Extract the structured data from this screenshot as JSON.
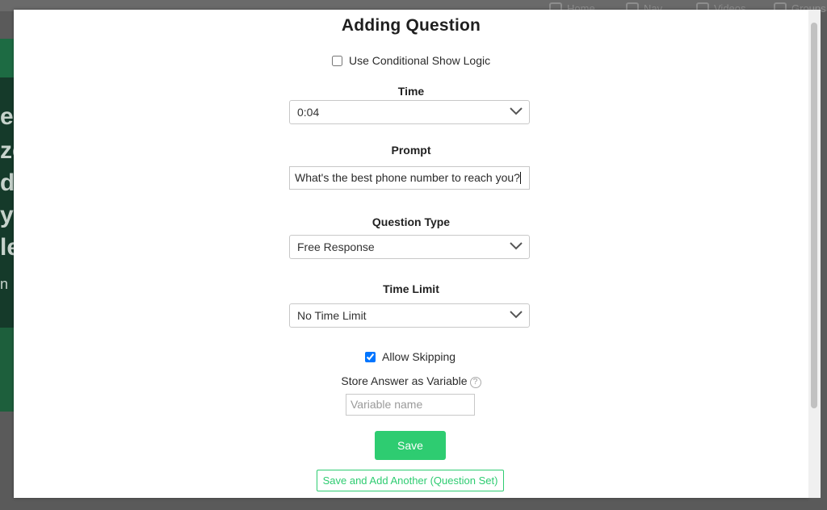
{
  "background_nav": {
    "items": [
      "Home",
      "Nav",
      "Videos",
      "Groups"
    ]
  },
  "background_letters": [
    "er",
    "ze",
    "d",
    "yo",
    "le",
    "n"
  ],
  "modal": {
    "title": "Adding Question",
    "conditional_logic": {
      "label": "Use Conditional Show Logic",
      "checked": false
    },
    "time": {
      "label": "Time",
      "value": "0:04"
    },
    "prompt": {
      "label": "Prompt",
      "value": "What's the best phone number to reach you?"
    },
    "question_type": {
      "label": "Question Type",
      "value": "Free Response"
    },
    "time_limit": {
      "label": "Time Limit",
      "value": "No Time Limit"
    },
    "allow_skipping": {
      "label": "Allow Skipping",
      "checked": true
    },
    "store_variable": {
      "label": "Store Answer as Variable",
      "help": "?",
      "placeholder": "Variable name"
    },
    "save_label": "Save",
    "save_another_label": "Save and Add Another (Question Set)"
  },
  "colors": {
    "accent": "#2ecc71",
    "checkbox": "#1a73e8"
  },
  "icons": {
    "select_arrow": "chevron-down-icon",
    "help": "question-circle-icon"
  }
}
